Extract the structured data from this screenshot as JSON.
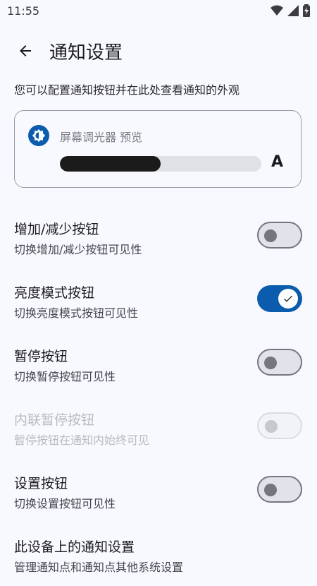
{
  "status": {
    "time": "11:55",
    "icons": [
      "wifi-icon",
      "signal-icon",
      "battery-charging-icon"
    ]
  },
  "header": {
    "back_icon": "arrow-back-icon",
    "title": "通知设置"
  },
  "description": "您可以配置通知按钮并在此处查看通知的外观",
  "preview": {
    "icon": "brightness-icon",
    "title": "屏幕调光器 预览",
    "progress": 0.5,
    "letter": "A"
  },
  "settings": [
    {
      "title": "增加/减少按钮",
      "subtitle": "切换增加/减少按钮可见性",
      "state": "off"
    },
    {
      "title": "亮度模式按钮",
      "subtitle": "切换亮度模式按钮可见性",
      "state": "on"
    },
    {
      "title": "暂停按钮",
      "subtitle": "切换暂停按钮可见性",
      "state": "off"
    },
    {
      "title": "内联暂停按钮",
      "subtitle": "暂停按钮在通知内始终可见",
      "state": "disabled"
    },
    {
      "title": "设置按钮",
      "subtitle": "切换设置按钮可见性",
      "state": "off"
    }
  ],
  "system_settings": {
    "title": "此设备上的通知设置",
    "subtitle": "管理通知点和通知点其他系统设置"
  },
  "colors": {
    "accent": "#0b5cad",
    "background": "#f8f9fe",
    "progress_fill": "#1b1b1b"
  }
}
